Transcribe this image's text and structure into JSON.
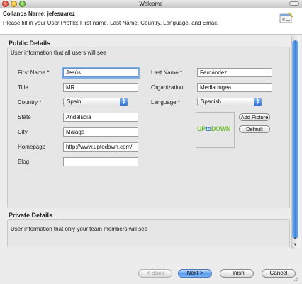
{
  "window": {
    "title": "Welcome"
  },
  "header": {
    "title": "Collanos Name: jefesuarez",
    "description": "Please fill in your User Profile: First name, Last Name, Country, Language, and Email."
  },
  "public": {
    "section_title": "Public Details",
    "description": "User information that all users will see",
    "first_name_label": "First Name *",
    "first_name_value": "Jesús",
    "last_name_label": "Last Name *",
    "last_name_value": "Fernández",
    "title_label": "Title",
    "title_value": "MR",
    "organization_label": "Organization",
    "organization_value": "Media Ingea",
    "country_label": "Country *",
    "country_value": "Spain",
    "language_label": "Language *",
    "language_value": "Spanish",
    "state_label": "State",
    "state_value": "Andalucía",
    "city_label": "City",
    "city_value": "Málaga",
    "homepage_label": "Homepage",
    "homepage_value": "http://www.uptodown.com/",
    "blog_label": "Blog",
    "blog_value": "",
    "add_picture_label": "Add Picture",
    "default_label": "Default",
    "logo": {
      "part1": "UP",
      "part2": "to",
      "part3": "DOWN"
    }
  },
  "private": {
    "section_title": "Private Details",
    "description": "User information that only your team members will see"
  },
  "buttons": {
    "back": "< Back",
    "next": "Next >",
    "finish": "Finish",
    "cancel": "Cancel"
  },
  "colors": {
    "accent": "#5b9cee",
    "logo_green": "#6cba2c",
    "logo_blue": "#2f7fd0"
  }
}
